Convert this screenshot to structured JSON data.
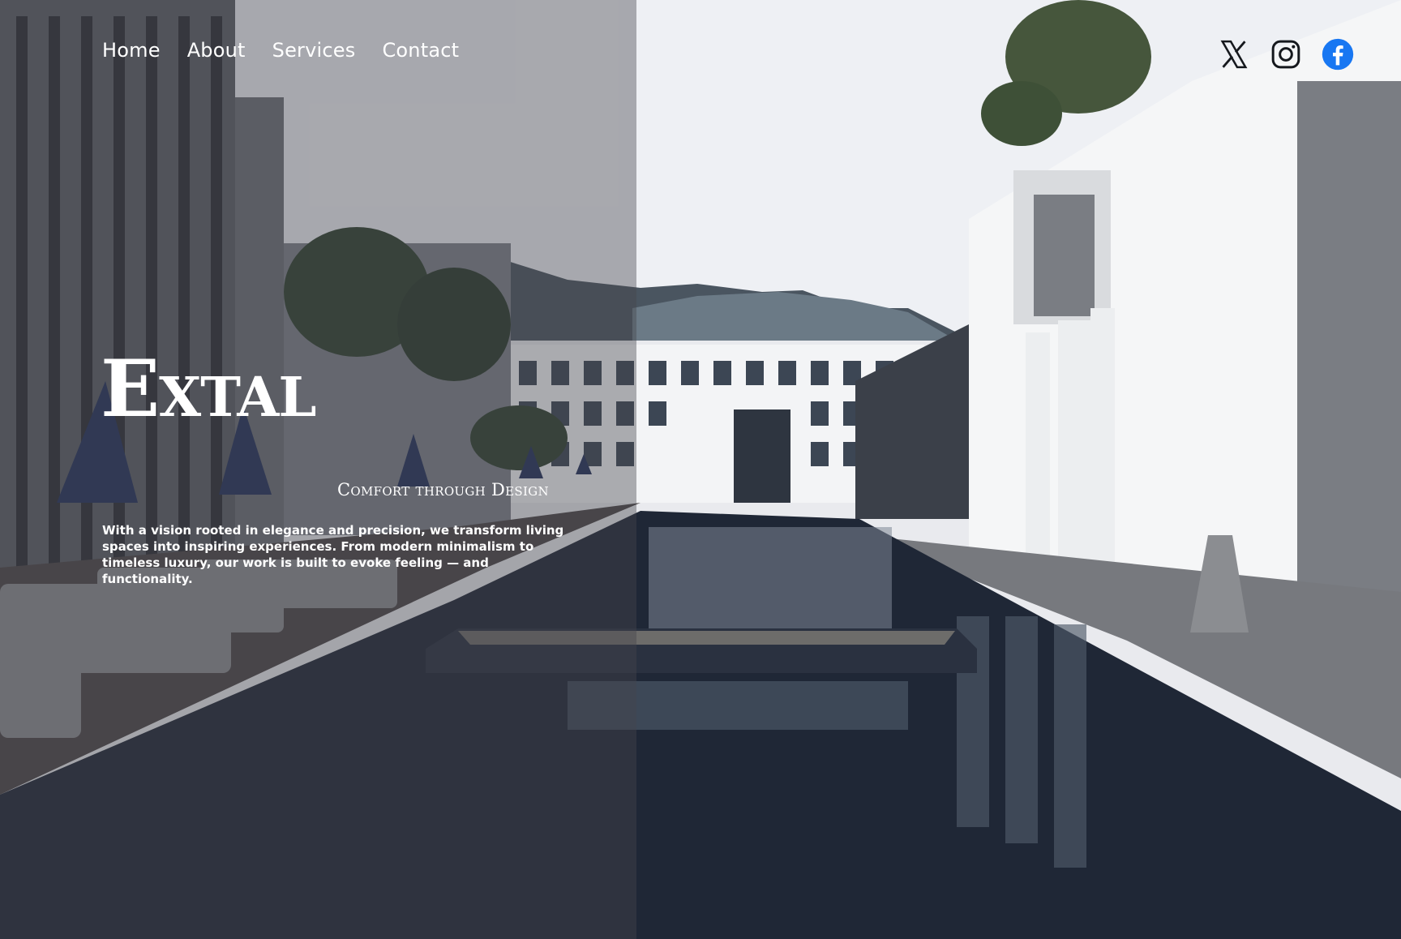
{
  "nav": {
    "items": [
      {
        "label": "Home"
      },
      {
        "label": "About"
      },
      {
        "label": "Services"
      },
      {
        "label": "Contact"
      }
    ]
  },
  "social": {
    "icons": [
      "x-icon",
      "instagram-icon",
      "facebook-icon"
    ],
    "facebook_color": "#1877F2"
  },
  "hero": {
    "title": "Extal",
    "subtitle": "Comfort through Design",
    "description": "With a vision rooted in elegance and precision, we transform living spaces into inspiring experiences. From modern minimalism to timeless luxury, our work is built to evoke feeling — and functionality."
  }
}
